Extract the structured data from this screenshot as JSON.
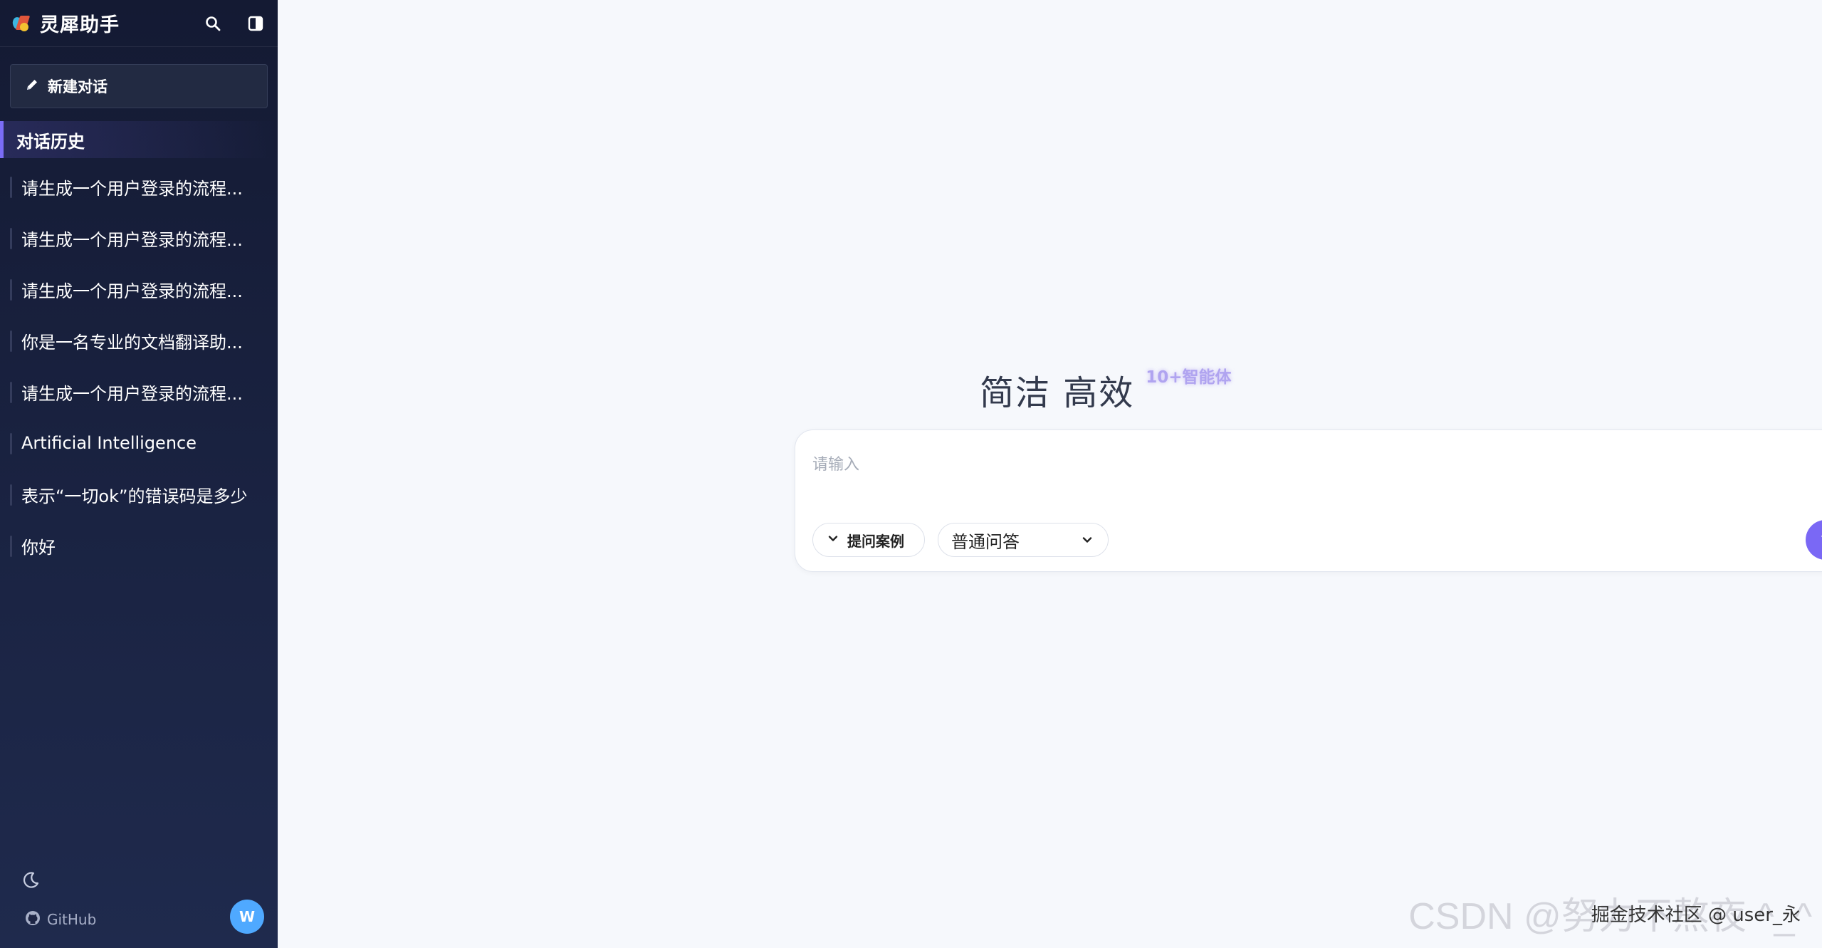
{
  "app": {
    "title": "灵犀助手"
  },
  "sidebar": {
    "new_chat_label": "新建对话",
    "history_title": "对话历史",
    "history": [
      {
        "label": "请生成一个用户登录的流程..."
      },
      {
        "label": "请生成一个用户登录的流程..."
      },
      {
        "label": "请生成一个用户登录的流程..."
      },
      {
        "label": "你是一名专业的文档翻译助..."
      },
      {
        "label": "请生成一个用户登录的流程..."
      },
      {
        "label": "Artificial Intelligence"
      },
      {
        "label": "表示“一切ok”的错误码是多少"
      },
      {
        "label": "你好"
      }
    ],
    "footer": {
      "github_label": "GitHub",
      "avatar_initial": "W",
      "theme_icon": "moon-icon"
    }
  },
  "main": {
    "hero_title": "简洁 高效",
    "hero_badge": "10+智能体",
    "input": {
      "placeholder": "请输入",
      "value": ""
    },
    "examples_label": "提问案例",
    "mode_selected": "普通问答",
    "send_symbol": "↑"
  },
  "watermark": {
    "csdn": "CSDN @努力不熬夜 ^_^",
    "juejin": "掘金技术社区 @ user_永"
  },
  "colors": {
    "accent": "#7a68f5",
    "sidebar_bg": "#141a33",
    "avatar": "#4fa9ff"
  }
}
